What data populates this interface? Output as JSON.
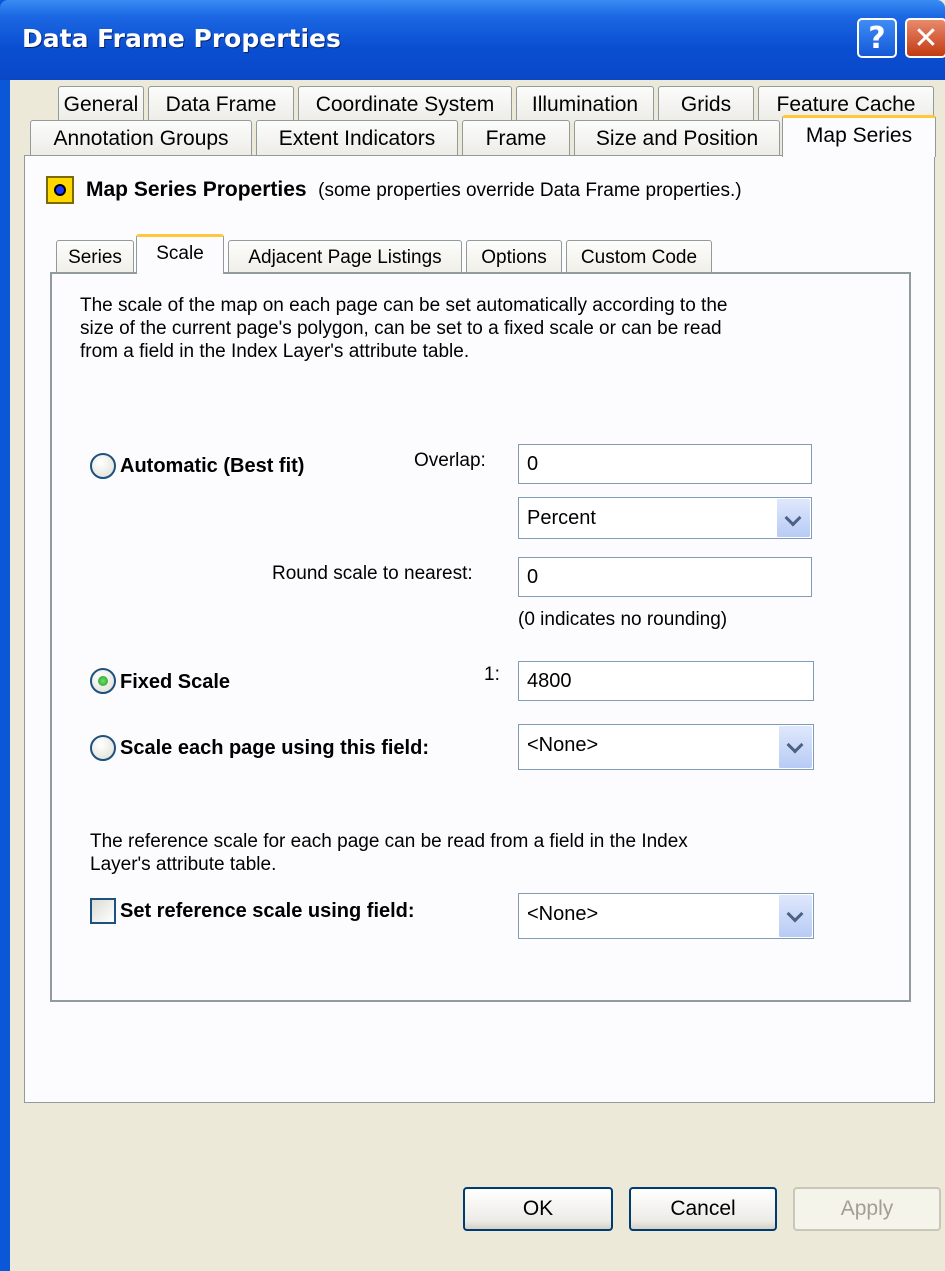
{
  "window": {
    "title": "Data Frame Properties"
  },
  "tabs_top": [
    "General",
    "Data Frame",
    "Coordinate System",
    "Illumination",
    "Grids",
    "Feature Cache"
  ],
  "tabs_bottom": [
    "Annotation Groups",
    "Extent Indicators",
    "Frame",
    "Size and Position",
    "Map Series"
  ],
  "active_tab": "Map Series",
  "header": {
    "title": "Map Series Properties",
    "note": "(some properties override Data Frame properties.)"
  },
  "subtabs": [
    "Series",
    "Scale",
    "Adjacent Page Listings",
    "Options",
    "Custom Code"
  ],
  "active_subtab": "Scale",
  "scale": {
    "description_lines": [
      "The scale of the map on each page can be set automatically according to the",
      "size of the current page's polygon, can be set to a fixed scale or can be read",
      "from a field in the Index Layer's attribute table."
    ],
    "automatic_label": "Automatic (Best fit)",
    "overlap_label": "Overlap:",
    "overlap_value": "0",
    "overlap_unit": "Percent",
    "round_label": "Round scale to nearest:",
    "round_value": "0",
    "round_hint": "(0 indicates no rounding)",
    "fixed_label": "Fixed Scale",
    "fixed_prefix": "1:",
    "fixed_value": "4800",
    "field_label": "Scale each page using this field:",
    "field_value": "<None>",
    "selected_mode": "fixed",
    "reference_lines": [
      "The reference scale for each page can be read from a field in the Index",
      "Layer's attribute table."
    ],
    "reference_label": "Set reference scale using field:",
    "reference_checked": false,
    "reference_value": "<None>"
  },
  "buttons": {
    "ok": "OK",
    "cancel": "Cancel",
    "apply": "Apply"
  },
  "colors": {
    "title_bar": "#0a4fd1",
    "active_tab_accent": "#ffc83c",
    "dialog_bg": "#ece9d8"
  }
}
